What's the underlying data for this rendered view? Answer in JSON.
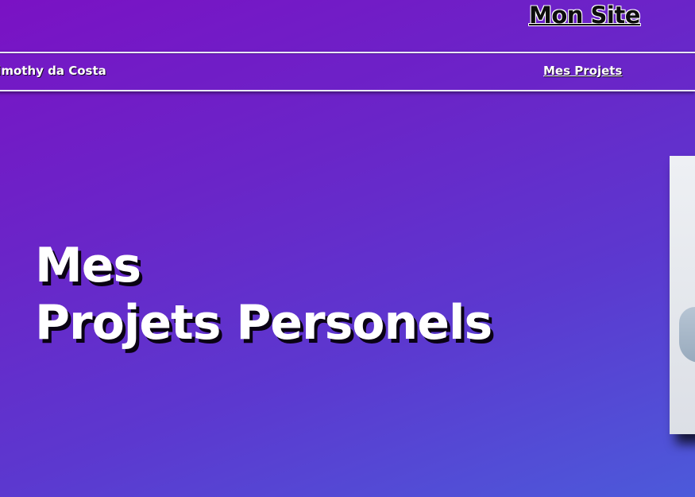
{
  "header": {
    "site_title": "Mon Site"
  },
  "nav": {
    "owner_name": "Timothy da Costa",
    "projects_link": "Mes Projets"
  },
  "hero": {
    "heading_line1": "Mes",
    "heading_line2": "Projets Personels"
  },
  "colors": {
    "background_start": "#7a12c4",
    "background_end": "#4c5ada",
    "text": "#ffffff",
    "shadow": "#0a0214"
  }
}
